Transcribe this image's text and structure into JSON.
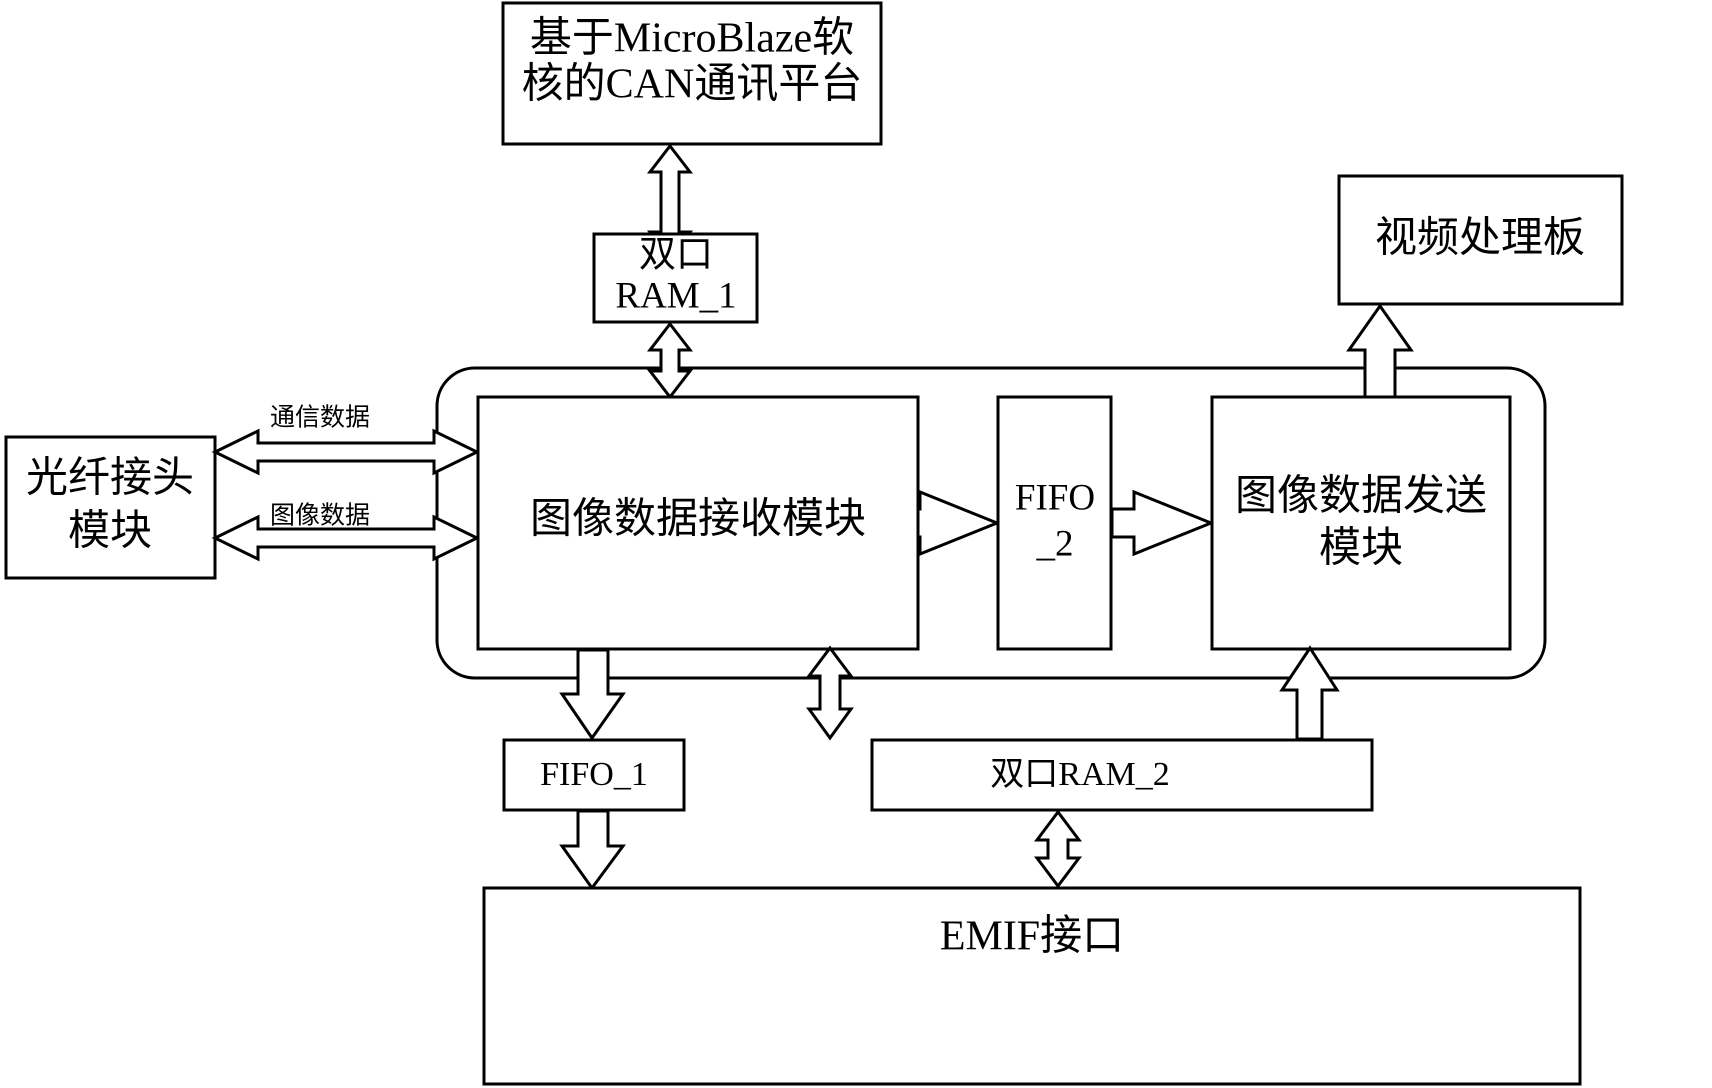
{
  "diagram": {
    "title": "FPGA image transmission block diagram",
    "colors": {
      "stroke": "#000000",
      "fill": "#ffffff",
      "background": "#ffffff"
    },
    "blocks": {
      "can_platform": {
        "label_line1": "基于MicroBlaze软",
        "label_line2": "核的CAN通讯平台"
      },
      "dpram1": {
        "label_line1": "双口",
        "label_line2": "RAM_1"
      },
      "video_board": {
        "label": "视频处理板"
      },
      "fiber_module": {
        "label_line1": "光纤接头",
        "label_line2": "模块"
      },
      "image_receive": {
        "label": "图像数据接收模块"
      },
      "fifo2": {
        "label_line1": "FIFO",
        "label_line2": "_2"
      },
      "image_send": {
        "label_line1": "图像数据发送",
        "label_line2": "模块"
      },
      "fifo1": {
        "label": "FIFO_1"
      },
      "dpram2": {
        "label": "双口RAM_2"
      },
      "emif": {
        "label": "EMIF接口"
      }
    },
    "edge_labels": {
      "comm_data": "通信数据",
      "image_data": "图像数据"
    },
    "connections": [
      {
        "name": "can-to-dpram1",
        "from": "can_platform",
        "to": "dpram1",
        "direction": "bidirectional",
        "orientation": "vertical"
      },
      {
        "name": "dpram1-to-image-receive",
        "from": "dpram1",
        "to": "image_receive",
        "direction": "bidirectional",
        "orientation": "vertical"
      },
      {
        "name": "fiber-comm-data",
        "from": "fiber_module",
        "to": "image_receive",
        "direction": "bidirectional",
        "orientation": "horizontal",
        "label": "通信数据"
      },
      {
        "name": "fiber-image-data",
        "from": "fiber_module",
        "to": "image_receive",
        "direction": "bidirectional",
        "orientation": "horizontal",
        "label": "图像数据"
      },
      {
        "name": "image-receive-to-fifo2",
        "from": "image_receive",
        "to": "fifo2",
        "direction": "forward",
        "orientation": "horizontal"
      },
      {
        "name": "fifo2-to-image-send",
        "from": "fifo2",
        "to": "image_send",
        "direction": "forward",
        "orientation": "horizontal"
      },
      {
        "name": "image-send-to-video-board",
        "from": "image_send",
        "to": "video_board",
        "direction": "forward",
        "orientation": "vertical-up"
      },
      {
        "name": "image-receive-to-fifo1",
        "from": "image_receive",
        "to": "fifo1",
        "direction": "forward",
        "orientation": "vertical-down"
      },
      {
        "name": "image-receive-to-dpram2",
        "from": "image_receive",
        "to": "dpram2",
        "direction": "bidirectional",
        "orientation": "vertical"
      },
      {
        "name": "dpram2-to-image-send",
        "from": "dpram2",
        "to": "image_send",
        "direction": "forward",
        "orientation": "vertical-up"
      },
      {
        "name": "fifo1-to-emif",
        "from": "fifo1",
        "to": "emif",
        "direction": "forward",
        "orientation": "vertical-down"
      },
      {
        "name": "dpram2-to-emif",
        "from": "dpram2",
        "to": "emif",
        "direction": "bidirectional",
        "orientation": "vertical"
      }
    ]
  }
}
